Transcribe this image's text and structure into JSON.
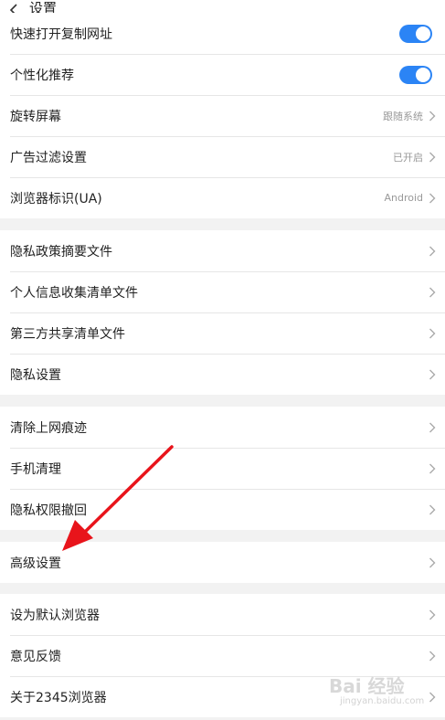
{
  "header": {
    "title": "设置"
  },
  "groups": [
    {
      "rows": [
        {
          "label": "快速打开复制网址",
          "toggle": true
        },
        {
          "label": "个性化推荐",
          "toggle": true
        },
        {
          "label": "旋转屏幕",
          "value": "跟随系统"
        },
        {
          "label": "广告过滤设置",
          "value": "已开启"
        },
        {
          "label": "浏览器标识(UA)",
          "value": "Android"
        }
      ]
    },
    {
      "rows": [
        {
          "label": "隐私政策摘要文件"
        },
        {
          "label": "个人信息收集清单文件"
        },
        {
          "label": "第三方共享清单文件"
        },
        {
          "label": "隐私设置"
        }
      ]
    },
    {
      "rows": [
        {
          "label": "清除上网痕迹"
        },
        {
          "label": "手机清理"
        },
        {
          "label": "隐私权限撤回"
        }
      ]
    },
    {
      "rows": [
        {
          "label": "高级设置"
        }
      ]
    },
    {
      "rows": [
        {
          "label": "设为默认浏览器"
        },
        {
          "label": "意见反馈"
        },
        {
          "label": "关于2345浏览器"
        }
      ]
    }
  ],
  "watermark": {
    "logo": "Bai 经验",
    "sub": "jingyan.baidu.com"
  },
  "colors": {
    "toggle_on": "#2b84f5",
    "arrow": "#e8141b"
  }
}
